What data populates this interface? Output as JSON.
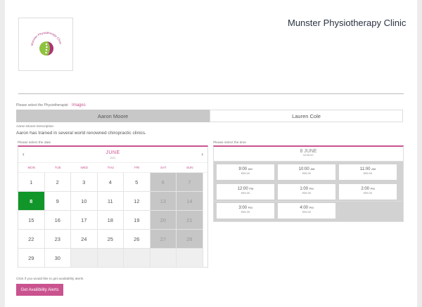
{
  "header": {
    "clinic_title": "Munster Physiotherapy Clinic",
    "logo_text": "Munster Physiotherapy Clinic",
    "accent_color": "#c9528f"
  },
  "therapist": {
    "select_label": "Please select the Physiotherapist",
    "images_link": "Images",
    "tabs": [
      "Aaron Moore",
      "Lauren Cole"
    ],
    "active_tab": "Aaron Moore",
    "description_label": "Aaron Moore Description",
    "description": "Aaron has trained in several world renowned chiropractic clinics."
  },
  "calendar": {
    "label": "Please select the date",
    "month": "JUNE",
    "year": "2021",
    "prev": "‹",
    "next": "›",
    "weekdays": [
      "MON",
      "TUE",
      "WED",
      "THU",
      "FRI",
      "SAT",
      "SUN"
    ],
    "selected_day": "8",
    "selected_color": "#119629",
    "days": [
      "1",
      "2",
      "3",
      "4",
      "5",
      "6",
      "7",
      "8",
      "9",
      "10",
      "11",
      "12",
      "13",
      "14",
      "15",
      "16",
      "17",
      "18",
      "19",
      "20",
      "21",
      "22",
      "23",
      "24",
      "25",
      "26",
      "27",
      "28",
      "29",
      "30"
    ]
  },
  "times": {
    "label": "Please select the time",
    "date": "8 JUNE",
    "weekday": "MONDAY",
    "slots": [
      {
        "time": "9:00",
        "ampm": "AM",
        "price": "€55.00"
      },
      {
        "time": "10:00",
        "ampm": "AM",
        "price": "€55.00"
      },
      {
        "time": "11:00",
        "ampm": "AM",
        "price": "€55.00"
      },
      {
        "time": "12:00",
        "ampm": "PM",
        "price": "€55.00"
      },
      {
        "time": "1:00",
        "ampm": "PM",
        "price": "€55.00"
      },
      {
        "time": "2:00",
        "ampm": "PM",
        "price": "€55.00"
      },
      {
        "time": "3:00",
        "ampm": "PM",
        "price": "€55.00"
      },
      {
        "time": "4:00",
        "ampm": "PM",
        "price": "€55.00"
      }
    ]
  },
  "alerts": {
    "label": "Click if you would like to get availability alerts",
    "button": "Get Availibility Alerts"
  }
}
